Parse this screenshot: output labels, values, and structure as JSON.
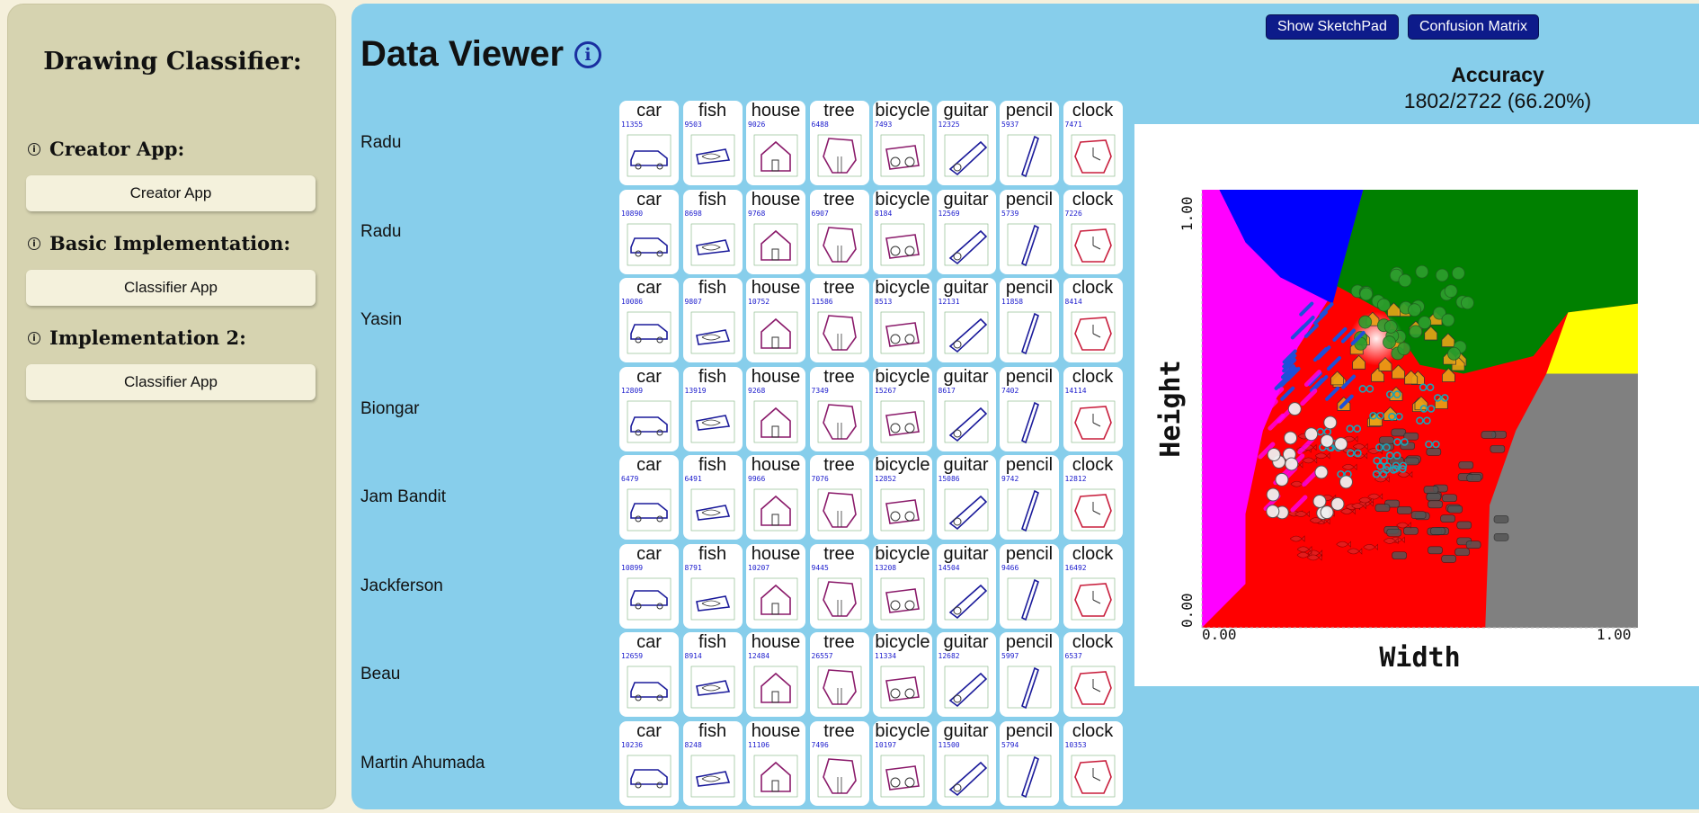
{
  "sidebar": {
    "title": "Drawing Classifier:",
    "sections": [
      {
        "heading": "Creator App:",
        "button": "Creator App"
      },
      {
        "heading": "Basic Implementation:",
        "button": "Classifier App"
      },
      {
        "heading": "Implementation 2:",
        "button": "Classifier App"
      }
    ]
  },
  "viewer": {
    "title": "Data Viewer",
    "info_glyph": "i"
  },
  "toolbar": {
    "sketchpad_label": "Show SketchPad",
    "confusion_label": "Confusion Matrix"
  },
  "accuracy": {
    "title": "Accuracy",
    "value": "1802/2722 (66.20%)"
  },
  "labels": [
    "car",
    "fish",
    "house",
    "tree",
    "bicycle",
    "guitar",
    "pencil",
    "clock"
  ],
  "rows": [
    {
      "name": "Radu",
      "ids": [
        "11355",
        "9503",
        "9026",
        "6488",
        "7493",
        "12325",
        "5937",
        "7471"
      ]
    },
    {
      "name": "Radu",
      "ids": [
        "10890",
        "8698",
        "9768",
        "6907",
        "8184",
        "12569",
        "5739",
        "7226"
      ]
    },
    {
      "name": "Yasin",
      "ids": [
        "10086",
        "9807",
        "10752",
        "11586",
        "8513",
        "12131",
        "11858",
        "8414"
      ]
    },
    {
      "name": "Biongar",
      "ids": [
        "12809",
        "13919",
        "9268",
        "7349",
        "15267",
        "8617",
        "7402",
        "14114"
      ]
    },
    {
      "name": "Jam Bandit",
      "ids": [
        "6479",
        "6491",
        "9966",
        "7076",
        "12852",
        "15086",
        "9742",
        "12812"
      ]
    },
    {
      "name": "Jackferson",
      "ids": [
        "10899",
        "8791",
        "10207",
        "9445",
        "13208",
        "14504",
        "9466",
        "16492"
      ]
    },
    {
      "name": "Beau",
      "ids": [
        "12659",
        "8914",
        "12484",
        "26557",
        "11334",
        "12682",
        "5997",
        "6537"
      ]
    },
    {
      "name": "Martin Ahumada",
      "ids": [
        "10236",
        "8248",
        "11106",
        "7496",
        "10197",
        "11500",
        "5794",
        "10353"
      ]
    }
  ],
  "chart_data": {
    "type": "scatter",
    "xlabel": "Width",
    "ylabel": "Height",
    "xlim": [
      0,
      1
    ],
    "ylim": [
      0,
      1
    ],
    "xticks": [
      "0.00",
      "1.00"
    ],
    "yticks": [
      "0.00",
      "1.00"
    ],
    "grid": false,
    "class_colors": {
      "car": "#808080",
      "fish": "#ff0000",
      "house": "#ffff00",
      "tree": "#008000",
      "bicycle": "#00ffff",
      "guitar": "#0000ff",
      "pencil": "#ff00ff",
      "clock": "#d3d3d3"
    }
  }
}
